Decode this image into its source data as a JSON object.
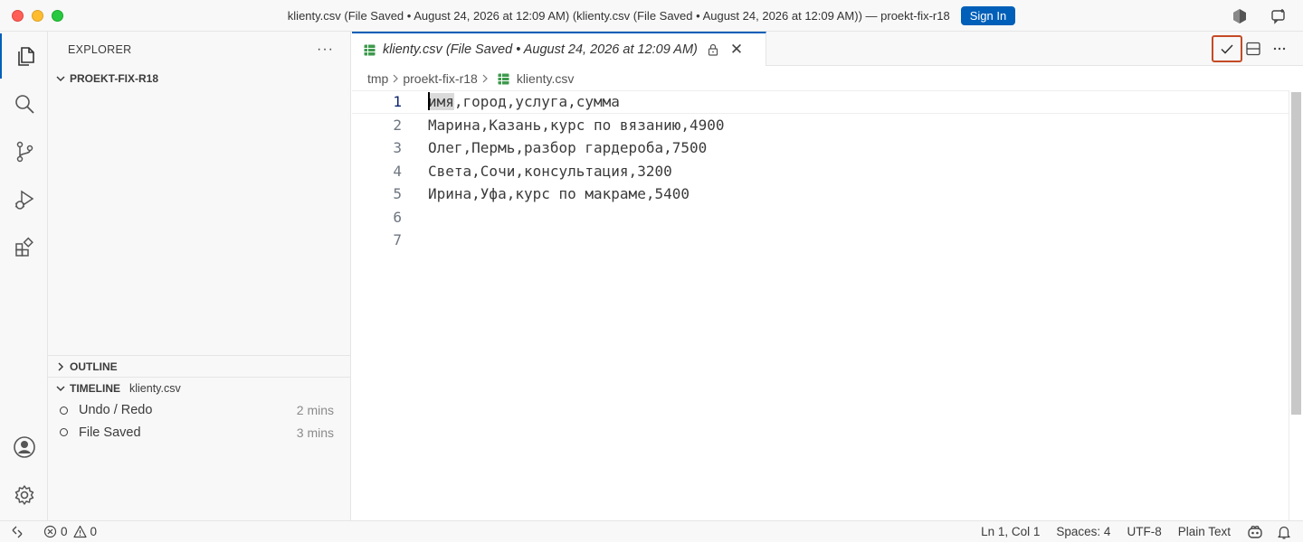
{
  "window": {
    "title": "klienty.csv (File Saved • August 24, 2026 at 12:09 AM) (klienty.csv (File Saved • August 24, 2026 at 12:09 AM)) — proekt-fix-r18",
    "sign_in_label": "Sign In"
  },
  "sidebar": {
    "header": "EXPLORER",
    "more": "···",
    "folder": "PROEKT-FIX-R18",
    "outline_label": "OUTLINE",
    "timeline_label": "TIMELINE",
    "timeline_file": "klienty.csv",
    "timeline_items": [
      {
        "label": "Undo / Redo",
        "time": "2 mins"
      },
      {
        "label": "File Saved",
        "time": "3 mins"
      }
    ]
  },
  "tab": {
    "label": "klienty.csv (File Saved • August 24, 2026 at 12:09 AM)",
    "close": "✕"
  },
  "breadcrumb": [
    "tmp",
    "proekt-fix-r18",
    "klienty.csv"
  ],
  "editor": {
    "lines": [
      {
        "num": "1",
        "text": "имя,город,услуга,сумма"
      },
      {
        "num": "2",
        "text": "Марина,Казань,курс по вязанию,4900"
      },
      {
        "num": "3",
        "text": "Олег,Пермь,разбор гардероба,7500"
      },
      {
        "num": "4",
        "text": "Света,Сочи,консультация,3200"
      },
      {
        "num": "5",
        "text": "Ирина,Уфа,курс по макраме,5400"
      },
      {
        "num": "6",
        "text": ""
      },
      {
        "num": "7",
        "text": ""
      }
    ],
    "first_word": "имя",
    "first_rest": ",город,услуга,сумма"
  },
  "status": {
    "errors": "0",
    "warnings": "0",
    "position": "Ln 1, Col 1",
    "spaces": "Spaces: 4",
    "encoding": "UTF-8",
    "language": "Plain Text"
  },
  "colors": {
    "accent": "#005fb8",
    "highlight_border": "#c44a26"
  }
}
